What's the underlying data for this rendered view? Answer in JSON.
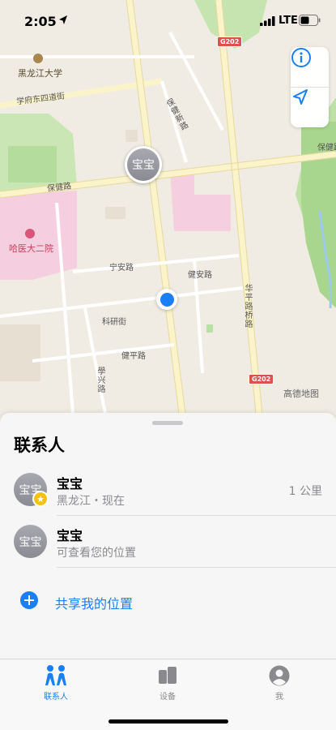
{
  "status": {
    "time": "2:05",
    "network": "LTE"
  },
  "map": {
    "labels": {
      "heilongjiang_univ": "黑龙江大学",
      "xuefu_road": "学府东四道街",
      "baojian_road_left": "保健路",
      "baojian_road_right": "保健路",
      "hospital": "哈医大二院",
      "ningan_road": "宁安路",
      "jianan_road": "健安路",
      "keyan_street": "科研街",
      "jianping_road": "健平路",
      "baojian_ne": "保健新路",
      "xuexing_road": "學兴路",
      "pingxin_road": "华平路桥路"
    },
    "highways": [
      "G202",
      "G202"
    ],
    "attribution": "高德地图",
    "friend_pin_label": "宝宝",
    "controls": {
      "info_icon": "info-icon",
      "location_icon": "location-arrow-icon"
    }
  },
  "sheet": {
    "title": "联系人",
    "people": [
      {
        "name": "宝宝",
        "avatar": "宝宝",
        "subtitle": "黑龙江・现在",
        "distance": "1 公里",
        "favorite": true
      },
      {
        "name": "宝宝",
        "avatar": "宝宝",
        "subtitle": "可查看您的位置",
        "distance": "",
        "favorite": false
      }
    ],
    "share_label": "共享我的位置"
  },
  "tabs": [
    {
      "label": "联系人",
      "icon": "people-icon",
      "active": true
    },
    {
      "label": "设备",
      "icon": "devices-icon",
      "active": false
    },
    {
      "label": "我",
      "icon": "person-icon",
      "active": false
    }
  ],
  "colors": {
    "accent": "#1a7ff5",
    "star": "#f4c20d",
    "highway": "#d9534f"
  }
}
